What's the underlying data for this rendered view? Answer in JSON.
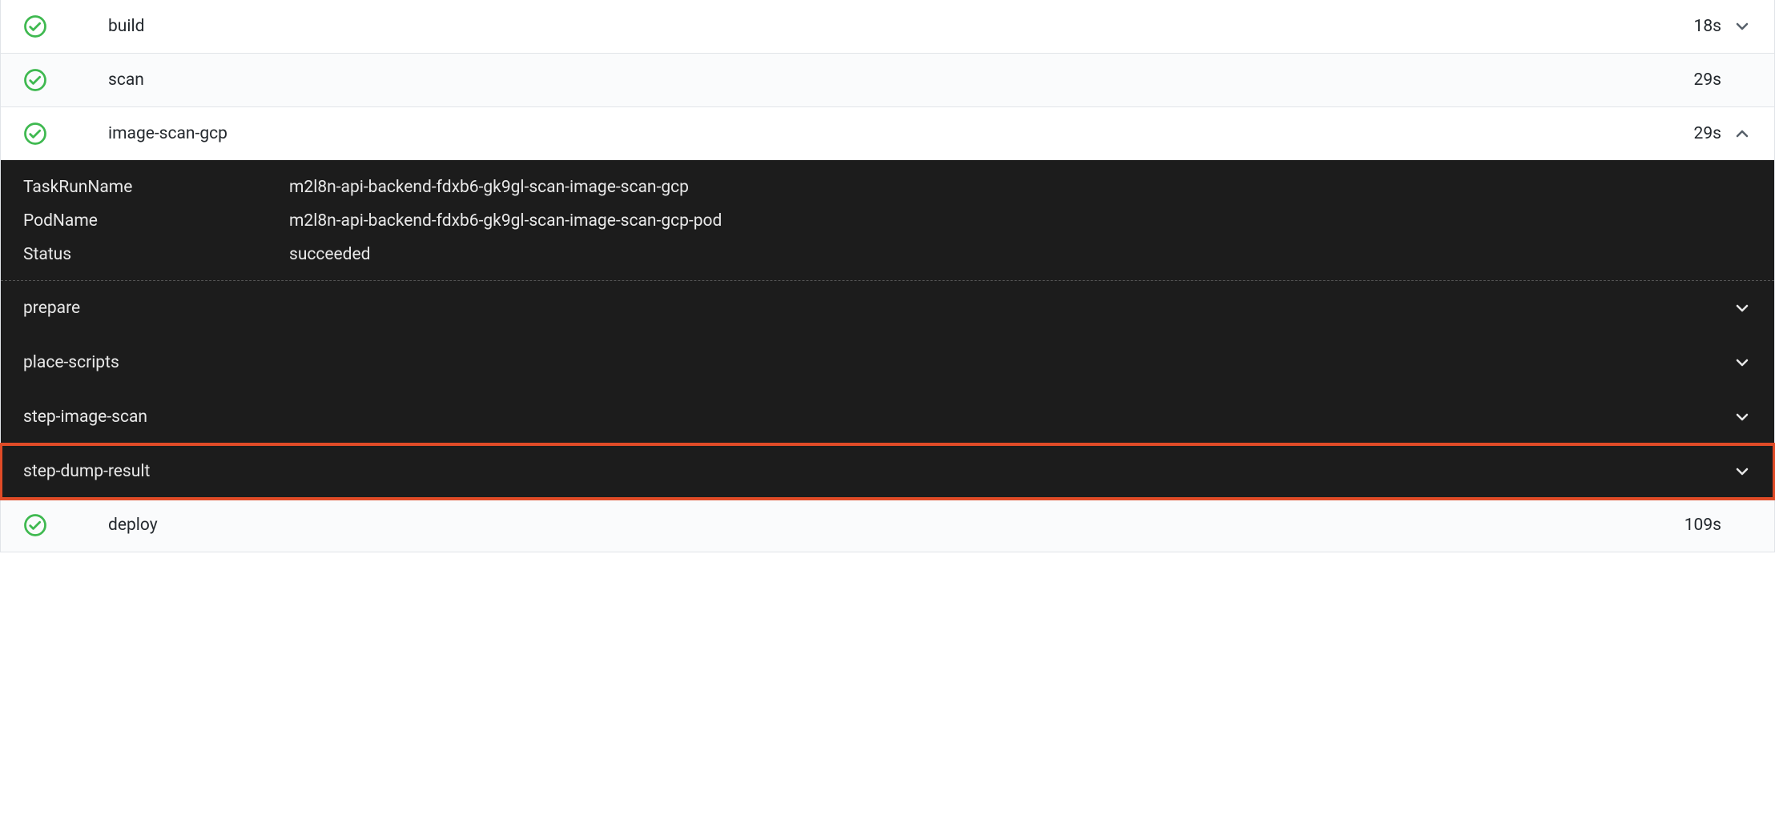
{
  "tasks": [
    {
      "name": "build",
      "duration": "18s",
      "expanded": false,
      "hasChevron": true
    },
    {
      "name": "scan",
      "duration": "29s",
      "expanded": false,
      "hasChevron": false
    },
    {
      "name": "image-scan-gcp",
      "duration": "29s",
      "expanded": true,
      "hasChevron": true
    },
    {
      "name": "deploy",
      "duration": "109s",
      "expanded": false,
      "hasChevron": false
    }
  ],
  "detail": {
    "meta": [
      {
        "label": "TaskRunName",
        "value": "m2l8n-api-backend-fdxb6-gk9gl-scan-image-scan-gcp"
      },
      {
        "label": "PodName",
        "value": "m2l8n-api-backend-fdxb6-gk9gl-scan-image-scan-gcp-pod"
      },
      {
        "label": "Status",
        "value": "succeeded"
      }
    ],
    "steps": [
      {
        "name": "prepare",
        "highlighted": false
      },
      {
        "name": "place-scripts",
        "highlighted": false
      },
      {
        "name": "step-image-scan",
        "highlighted": false
      },
      {
        "name": "step-dump-result",
        "highlighted": true
      }
    ]
  }
}
